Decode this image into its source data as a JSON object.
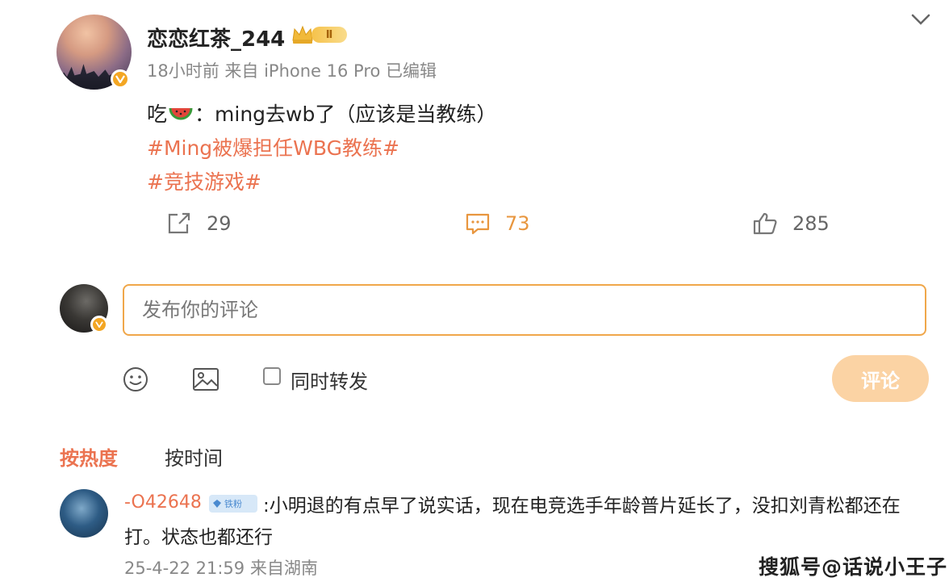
{
  "post": {
    "username": "恋恋红茶_244",
    "vip_level": "Ⅱ",
    "meta": "18小时前 来自 iPhone 16 Pro 已编辑",
    "text_prefix": "吃",
    "text_body": "：ming去wb了（应该是当教练）",
    "hashtags": [
      "#Ming被爆担任WBG教练#",
      "#竞技游戏#"
    ],
    "actions": {
      "repost_count": "29",
      "comment_count": "73",
      "like_count": "285"
    }
  },
  "composer": {
    "placeholder": "发布你的评论",
    "repost_label": "同时转发",
    "submit_label": "评论"
  },
  "sort_tabs": [
    "按热度",
    "按时间"
  ],
  "comments": [
    {
      "user": "-O42648",
      "badge": "铁粉",
      "text_line1": ":小明退的有点早了说实话，现在电竞选手年龄普片延长了，没扣刘青松都还在",
      "text_line2": "打。状态也都还行",
      "meta": "25-4-22 21:59 来自湖南"
    }
  ],
  "watermark": "搜狐号@话说小王子",
  "colors": {
    "accent_orange": "#eb7350",
    "input_border": "#f0a74a",
    "submit_disabled": "#fbd3a4"
  }
}
